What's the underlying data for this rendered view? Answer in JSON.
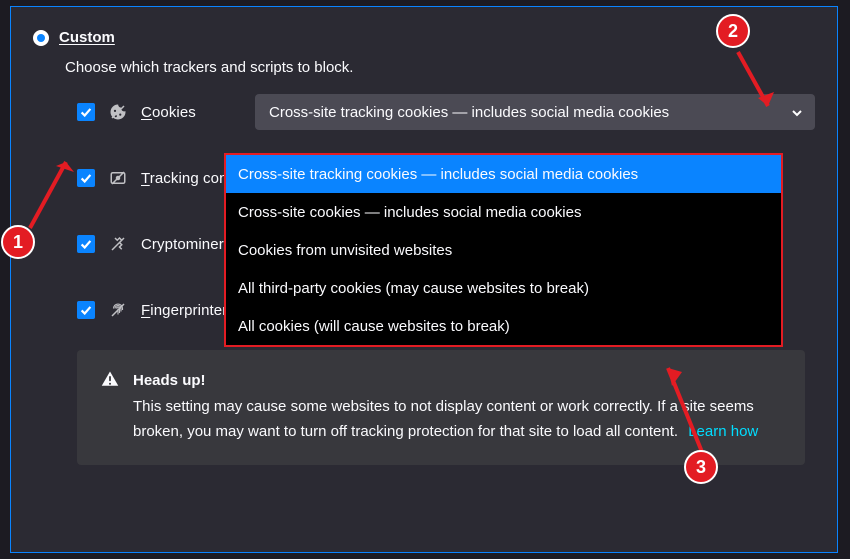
{
  "radio": {
    "label": "Custom"
  },
  "subtitle": "Choose which trackers and scripts to block.",
  "options": {
    "cookies": {
      "label_pre": "C",
      "label_rest": "ookies"
    },
    "tracking": {
      "label_pre": "T",
      "label_rest": "racking content"
    },
    "crypto": {
      "label": "Cryptominers"
    },
    "finger": {
      "label_pre": "F",
      "label_rest": "ingerprinters"
    }
  },
  "select": {
    "value": "Cross-site tracking cookies — includes social media cookies"
  },
  "dropdown": {
    "items": [
      "Cross-site tracking cookies — includes social media cookies",
      "Cross-site cookies — includes social media cookies",
      "Cookies from unvisited websites",
      "All third-party cookies (may cause websites to break)",
      "All cookies (will cause websites to break)"
    ]
  },
  "warn": {
    "title": "Heads up!",
    "body": "This setting may cause some websites to not display content or work correctly. If a site seems broken, you may want to turn off tracking protection for that site to load all content.",
    "link": "Learn how"
  },
  "callouts": {
    "a": "1",
    "b": "2",
    "c": "3"
  }
}
